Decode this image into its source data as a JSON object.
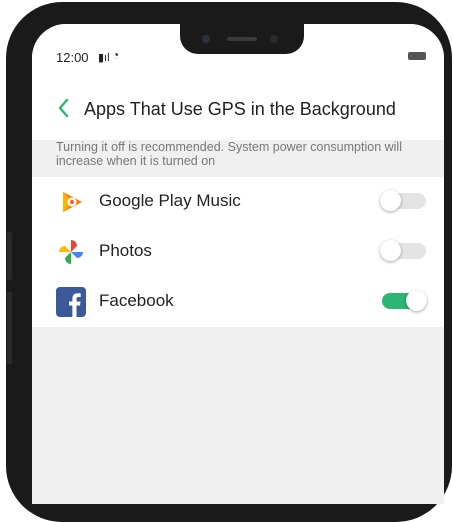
{
  "status_bar": {
    "time": "12:00",
    "signal_icon": "signal-icon",
    "wifi_icon": "wifi-icon",
    "battery_icon": "battery-icon"
  },
  "header": {
    "title": "Apps That Use GPS in the Background",
    "back_icon": "back-arrow-icon"
  },
  "hint": "Turning it off is recommended. System power consumption will increase when it is turned on",
  "apps": [
    {
      "name": "Google Play Music",
      "icon": "google-play-music-icon",
      "enabled": false
    },
    {
      "name": "Photos",
      "icon": "photos-icon",
      "enabled": false
    },
    {
      "name": "Facebook",
      "icon": "facebook-icon",
      "enabled": true
    }
  ],
  "colors": {
    "accent": "#2bb673",
    "background": "#f0f0f0",
    "facebook": "#3b5998"
  }
}
